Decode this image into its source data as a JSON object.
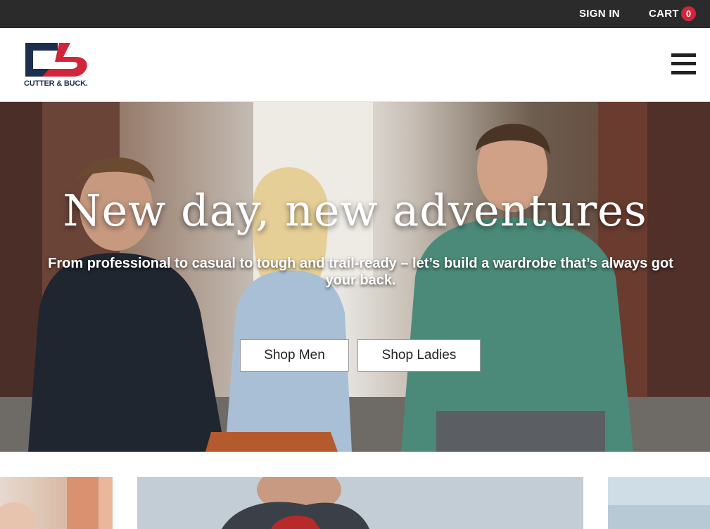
{
  "topbar": {
    "signin_label": "SIGN IN",
    "cart_label": "CART",
    "cart_count": "0"
  },
  "header": {
    "logo_text": "CUTTER & BUCK.",
    "menu_icon": "hamburger-menu-icon"
  },
  "hero": {
    "title": "New day, new adventures",
    "subtitle": "From professional to casual to tough and trail-ready – let’s build a wardrobe that’s always got your back.",
    "buttons": [
      {
        "label": "Shop Men"
      },
      {
        "label": "Shop Ladies"
      }
    ]
  },
  "colors": {
    "topbar_bg": "#2b2b2b",
    "brand_navy": "#1c2f4f",
    "brand_red": "#d1253a",
    "text_white": "#ffffff"
  }
}
